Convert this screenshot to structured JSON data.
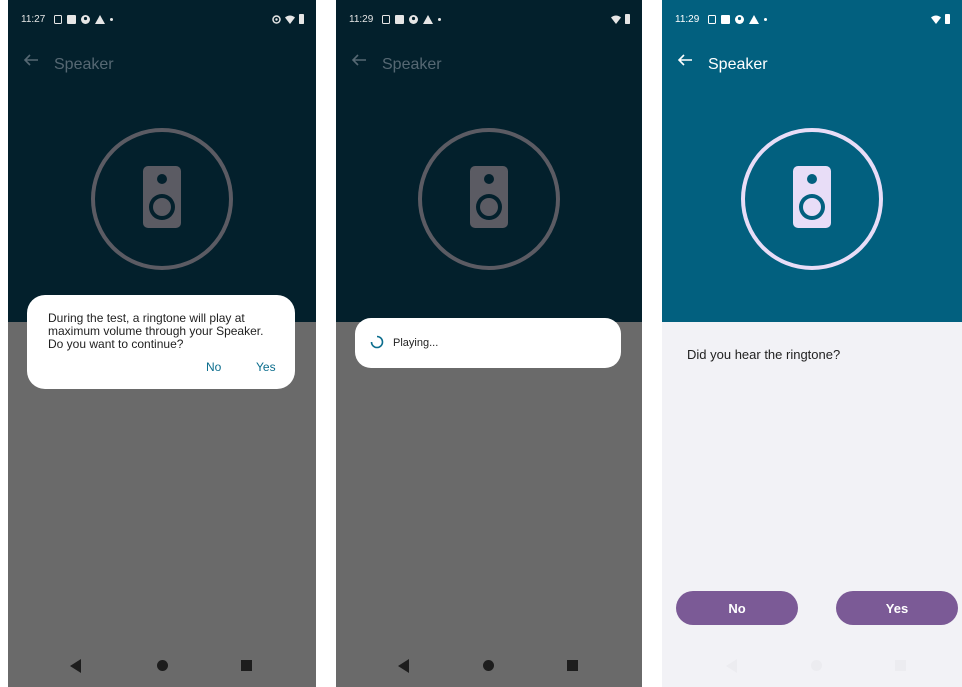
{
  "phones": [
    {
      "status": {
        "time": "11:27"
      },
      "header": {
        "title": "Speaker"
      },
      "dialog": {
        "message": "During the test, a ringtone will play at maximum volume through your Speaker. Do you want to continue?",
        "no_label": "No",
        "yes_label": "Yes"
      }
    },
    {
      "status": {
        "time": "11:29"
      },
      "header": {
        "title": "Speaker"
      },
      "dialog": {
        "playing_label": "Playing..."
      }
    },
    {
      "status": {
        "time": "11:29"
      },
      "header": {
        "title": "Speaker"
      },
      "question": "Did you hear the ringtone?",
      "no_label": "No",
      "yes_label": "Yes"
    }
  ],
  "icons": {
    "back": "arrow-left-icon",
    "speaker": "speaker-icon",
    "nav_back": "triangle-back-icon",
    "nav_home": "circle-home-icon",
    "nav_recent": "square-recents-icon"
  },
  "colors": {
    "header_dark": "#03202c",
    "overlay_gray": "#6a6a6a",
    "header_teal": "#02607f",
    "light_bg": "#f2f2f6",
    "button_purple": "#7b5a96",
    "speaker_light": "#e8ddf7",
    "speaker_dim": "#5b5b63",
    "dialog_button_text": "#0b6d8d"
  }
}
